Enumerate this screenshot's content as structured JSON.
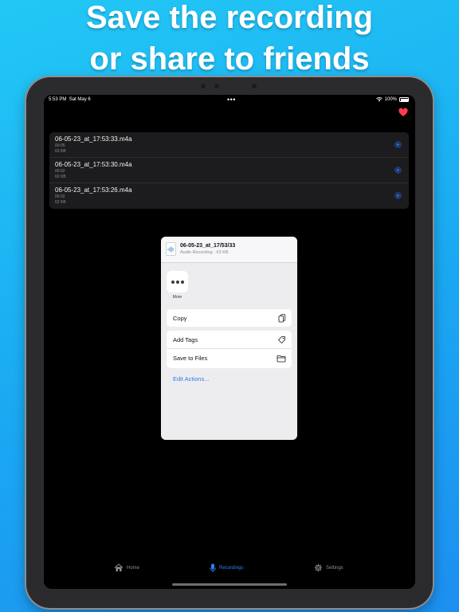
{
  "headline": {
    "line1": "Save the recording",
    "line2": "or share to friends"
  },
  "status_bar": {
    "time": "5:53 PM",
    "date": "Sat May 6",
    "dots": "•••",
    "battery": "100%"
  },
  "recordings": [
    {
      "name": "06-05-23_at_17:53:33.m4a",
      "duration": "00:05",
      "size": "63 KB"
    },
    {
      "name": "06-05-23_at_17:53:30.m4a",
      "duration": "00:02",
      "size": "62 KB"
    },
    {
      "name": "06-05-23_at_17:53:26.m4a",
      "duration": "00:02",
      "size": "62 KB"
    }
  ],
  "share_sheet": {
    "file_title": "06-05-23_at_17/53/33",
    "file_subtitle": "Audio Recording · 63 KB",
    "more_label": "More",
    "actions_group1": [
      {
        "label": "Copy",
        "icon": "copy-icon"
      }
    ],
    "actions_group2": [
      {
        "label": "Add Tags",
        "icon": "tag-icon"
      },
      {
        "label": "Save to Files",
        "icon": "folder-icon"
      }
    ],
    "edit_actions": "Edit Actions..."
  },
  "tab_bar": {
    "tabs": [
      {
        "label": "Home",
        "icon": "house-icon",
        "active": false
      },
      {
        "label": "Recordings",
        "icon": "microphone-icon",
        "active": true
      },
      {
        "label": "Settings",
        "icon": "gear-icon",
        "active": false
      }
    ]
  },
  "colors": {
    "background_gradient": [
      "#22c8f5",
      "#1d8ff0"
    ],
    "accent": "#2f80ed",
    "heart": "#ff3b4a"
  }
}
